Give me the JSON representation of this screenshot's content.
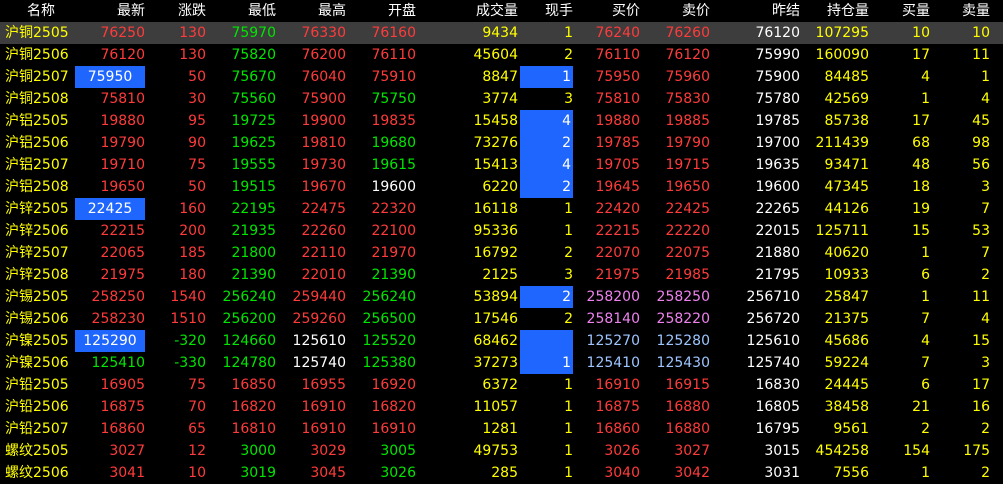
{
  "colors": {
    "up": "#ff3b3b",
    "down": "#00e600",
    "flat": "#ffffff",
    "volume": "#ffff00",
    "name": "#ffff00",
    "bid_ask_bg_text": "#ff3b3b",
    "alt_price": "#ee82ee",
    "alt_price2": "#9ec5ff",
    "highlight": "#1f66ff",
    "selected_row": "#3d3d3d"
  },
  "header": [
    "名称",
    "最新",
    "涨跌",
    "最低",
    "最高",
    "开盘",
    "成交量",
    "现手",
    "买价",
    "卖价",
    "昨结",
    "持仓量",
    "买量",
    "卖量"
  ],
  "rows": [
    {
      "name": "沪铜2505",
      "last": "76250",
      "chg": "130",
      "low": "75970",
      "high": "76330",
      "open": "76160",
      "vol": "9434",
      "cur": "1",
      "bid": "76240",
      "ask": "76260",
      "prev": "76120",
      "oi": "107295",
      "bidv": "10",
      "askv": "10",
      "selected": true
    },
    {
      "name": "沪铜2506",
      "last": "76120",
      "chg": "130",
      "low": "75820",
      "high": "76200",
      "open": "76110",
      "vol": "45604",
      "cur": "2",
      "bid": "76110",
      "ask": "76120",
      "prev": "75990",
      "oi": "160090",
      "bidv": "17",
      "askv": "11"
    },
    {
      "name": "沪铜2507",
      "last": "75950",
      "chg": "50",
      "low": "75670",
      "high": "76040",
      "open": "75910",
      "vol": "8847",
      "cur": "1",
      "bid": "75950",
      "ask": "75960",
      "prev": "75900",
      "oi": "84485",
      "bidv": "4",
      "askv": "1"
    },
    {
      "name": "沪铜2508",
      "last": "75810",
      "chg": "30",
      "low": "75560",
      "high": "75900",
      "open": "75750",
      "vol": "3774",
      "cur": "3",
      "bid": "75810",
      "ask": "75830",
      "prev": "75780",
      "oi": "42569",
      "bidv": "1",
      "askv": "4"
    },
    {
      "name": "沪铝2505",
      "last": "19880",
      "chg": "95",
      "low": "19725",
      "high": "19900",
      "open": "19835",
      "vol": "15458",
      "cur": "4",
      "bid": "19880",
      "ask": "19885",
      "prev": "19785",
      "oi": "85738",
      "bidv": "17",
      "askv": "45"
    },
    {
      "name": "沪铝2506",
      "last": "19790",
      "chg": "90",
      "low": "19625",
      "high": "19810",
      "open": "19680",
      "vol": "73276",
      "cur": "2",
      "bid": "19785",
      "ask": "19790",
      "prev": "19700",
      "oi": "211439",
      "bidv": "68",
      "askv": "98"
    },
    {
      "name": "沪铝2507",
      "last": "19710",
      "chg": "75",
      "low": "19555",
      "high": "19730",
      "open": "19615",
      "vol": "15413",
      "cur": "4",
      "bid": "19705",
      "ask": "19715",
      "prev": "19635",
      "oi": "93471",
      "bidv": "48",
      "askv": "56"
    },
    {
      "name": "沪铝2508",
      "last": "19650",
      "chg": "50",
      "low": "19515",
      "high": "19670",
      "open": "19600",
      "vol": "6220",
      "cur": "2",
      "bid": "19645",
      "ask": "19650",
      "prev": "19600",
      "oi": "47345",
      "bidv": "18",
      "askv": "3"
    },
    {
      "name": "沪锌2505",
      "last": "22425",
      "chg": "160",
      "low": "22195",
      "high": "22475",
      "open": "22320",
      "vol": "16118",
      "cur": "1",
      "bid": "22420",
      "ask": "22425",
      "prev": "22265",
      "oi": "44126",
      "bidv": "19",
      "askv": "7"
    },
    {
      "name": "沪锌2506",
      "last": "22215",
      "chg": "200",
      "low": "21935",
      "high": "22260",
      "open": "22100",
      "vol": "95336",
      "cur": "1",
      "bid": "22215",
      "ask": "22220",
      "prev": "22015",
      "oi": "125711",
      "bidv": "15",
      "askv": "53"
    },
    {
      "name": "沪锌2507",
      "last": "22065",
      "chg": "185",
      "low": "21800",
      "high": "22110",
      "open": "21970",
      "vol": "16792",
      "cur": "2",
      "bid": "22070",
      "ask": "22075",
      "prev": "21880",
      "oi": "40620",
      "bidv": "1",
      "askv": "7"
    },
    {
      "name": "沪锌2508",
      "last": "21975",
      "chg": "180",
      "low": "21390",
      "high": "22010",
      "open": "21390",
      "vol": "2125",
      "cur": "3",
      "bid": "21975",
      "ask": "21985",
      "prev": "21795",
      "oi": "10933",
      "bidv": "6",
      "askv": "2"
    },
    {
      "name": "沪锡2505",
      "last": "258250",
      "chg": "1540",
      "low": "256240",
      "high": "259440",
      "open": "256240",
      "vol": "53894",
      "cur": "2",
      "bid": "258200",
      "ask": "258250",
      "prev": "256710",
      "oi": "25847",
      "bidv": "1",
      "askv": "11"
    },
    {
      "name": "沪锡2506",
      "last": "258230",
      "chg": "1510",
      "low": "256200",
      "high": "259260",
      "open": "256500",
      "vol": "17546",
      "cur": "2",
      "bid": "258140",
      "ask": "258220",
      "prev": "256720",
      "oi": "21375",
      "bidv": "7",
      "askv": "4"
    },
    {
      "name": "沪镍2505",
      "last": "125290",
      "chg": "-320",
      "low": "124660",
      "high": "125610",
      "open": "125520",
      "vol": "68462",
      "cur": "",
      "bid": "125270",
      "ask": "125280",
      "prev": "125610",
      "oi": "45686",
      "bidv": "4",
      "askv": "15"
    },
    {
      "name": "沪镍2506",
      "last": "125410",
      "chg": "-330",
      "low": "124780",
      "high": "125740",
      "open": "125380",
      "vol": "37273",
      "cur": "1",
      "bid": "125410",
      "ask": "125430",
      "prev": "125740",
      "oi": "59224",
      "bidv": "7",
      "askv": "3"
    },
    {
      "name": "沪铅2505",
      "last": "16905",
      "chg": "75",
      "low": "16850",
      "high": "16955",
      "open": "16920",
      "vol": "6372",
      "cur": "1",
      "bid": "16910",
      "ask": "16915",
      "prev": "16830",
      "oi": "24445",
      "bidv": "6",
      "askv": "17"
    },
    {
      "name": "沪铅2506",
      "last": "16875",
      "chg": "70",
      "low": "16820",
      "high": "16910",
      "open": "16820",
      "vol": "11057",
      "cur": "1",
      "bid": "16875",
      "ask": "16880",
      "prev": "16805",
      "oi": "38458",
      "bidv": "21",
      "askv": "16"
    },
    {
      "name": "沪铅2507",
      "last": "16860",
      "chg": "65",
      "low": "16810",
      "high": "16910",
      "open": "16910",
      "vol": "1281",
      "cur": "1",
      "bid": "16860",
      "ask": "16880",
      "prev": "16795",
      "oi": "9561",
      "bidv": "2",
      "askv": "2"
    },
    {
      "name": "螺纹2505",
      "last": "3027",
      "chg": "12",
      "low": "3000",
      "high": "3029",
      "open": "3005",
      "vol": "49753",
      "cur": "1",
      "bid": "3026",
      "ask": "3027",
      "prev": "3015",
      "oi": "454258",
      "bidv": "154",
      "askv": "175"
    },
    {
      "name": "螺纹2506",
      "last": "3041",
      "chg": "10",
      "low": "3019",
      "high": "3045",
      "open": "3026",
      "vol": "285",
      "cur": "1",
      "bid": "3040",
      "ask": "3042",
      "prev": "3031",
      "oi": "7556",
      "bidv": "1",
      "askv": "2"
    }
  ]
}
